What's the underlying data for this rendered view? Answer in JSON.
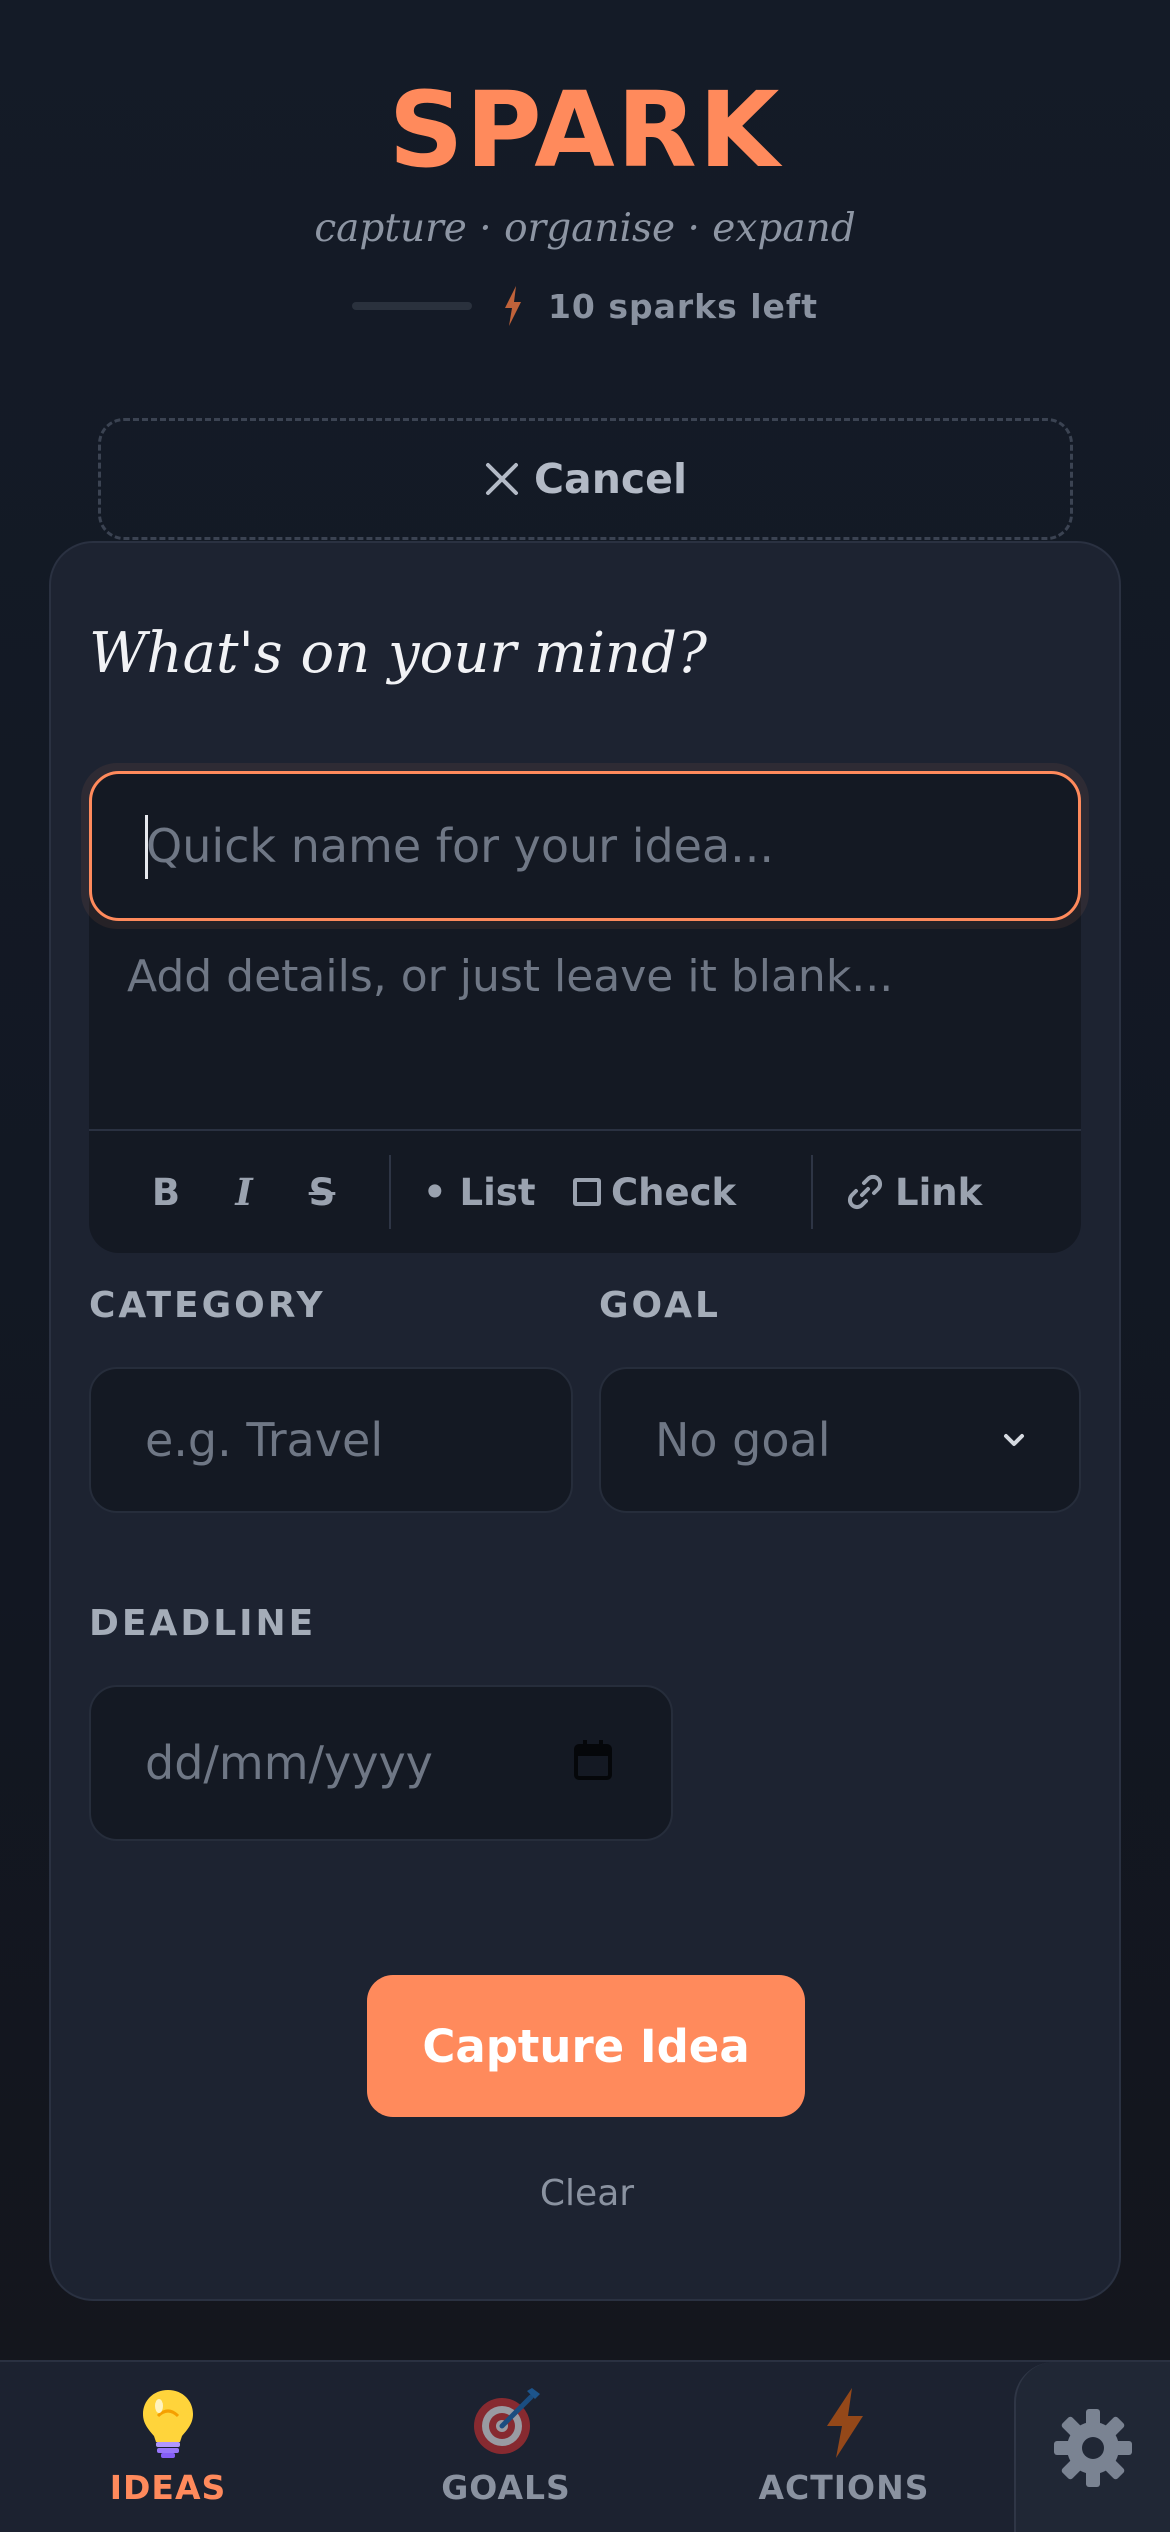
{
  "header": {
    "brand": "SPARK",
    "tagline": "capture · organise · expand",
    "sparks_left": "10 sparks left"
  },
  "cancel": {
    "label": "Cancel"
  },
  "form": {
    "title": "What's on your mind?",
    "idea_name_placeholder": "Quick name for your idea...",
    "details_placeholder": "Add details, or just leave it blank...",
    "toolbar": {
      "bold": "B",
      "italic": "I",
      "strike": "S",
      "list": "• List",
      "check": "Check",
      "link": "Link"
    },
    "category_label": "CATEGORY",
    "category_placeholder": "e.g. Travel",
    "goal_label": "GOAL",
    "goal_value": "No goal",
    "deadline_label": "DEADLINE",
    "deadline_placeholder": "dd/mm/yyyy",
    "capture_label": "Capture Idea",
    "clear_label": "Clear"
  },
  "nav": {
    "items": [
      {
        "label": "IDEAS",
        "icon": "lightbulb-icon",
        "active": true
      },
      {
        "label": "GOALS",
        "icon": "target-icon",
        "active": false
      },
      {
        "label": "ACTIONS",
        "icon": "lightning-icon",
        "active": false
      }
    ],
    "settings_icon": "gear-icon"
  },
  "colors": {
    "accent": "#ff8a5c",
    "background": "#131822",
    "card": "#1d2331",
    "field": "#141923"
  }
}
